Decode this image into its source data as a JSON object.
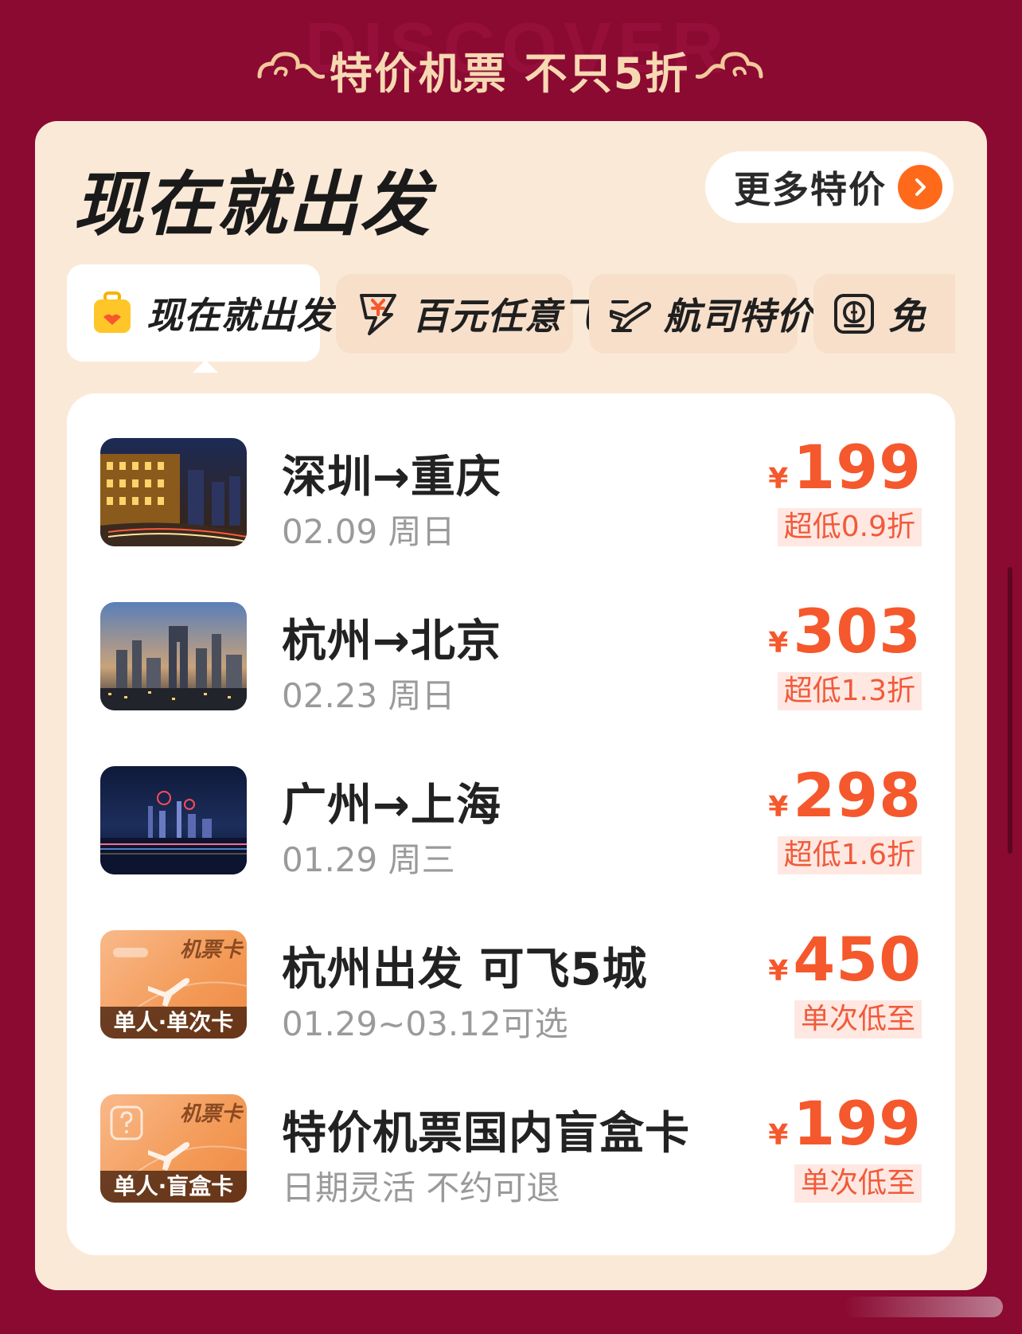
{
  "banner": {
    "ghost_text": "DISCOVER",
    "title": "特价机票 不只5折"
  },
  "card": {
    "title": "现在就出发",
    "more_label": "更多特价"
  },
  "tabs": [
    {
      "label": "现在就出发",
      "icon": "suitcase-icon",
      "active": true
    },
    {
      "label": "百元任意飞",
      "icon": "yen-lightning-icon",
      "active": false
    },
    {
      "label": "航司特价",
      "icon": "airplane-ticket-icon",
      "active": false
    },
    {
      "label": "免",
      "icon": "passport-icon",
      "active": false
    }
  ],
  "deals": [
    {
      "title": "深圳→重庆",
      "subtitle": "02.09 周日",
      "currency": "¥",
      "price": "199",
      "badge": "超低0.9折",
      "thumb": "chongqing-night-photo"
    },
    {
      "title": "杭州→北京",
      "subtitle": "02.23 周日",
      "currency": "¥",
      "price": "303",
      "badge": "超低1.3折",
      "thumb": "beijing-skyline-photo"
    },
    {
      "title": "广州→上海",
      "subtitle": "01.29 周三",
      "currency": "¥",
      "price": "298",
      "badge": "超低1.6折",
      "thumb": "shanghai-bund-photo"
    },
    {
      "title": "杭州出发 可飞5城",
      "subtitle": "01.29~03.12可选",
      "currency": "¥",
      "price": "450",
      "badge": "单次低至",
      "thumb_tag": "机票卡",
      "thumb_label": "单人·单次卡"
    },
    {
      "title": "特价机票国内盲盒卡",
      "subtitle": "日期灵活 不约可退",
      "currency": "¥",
      "price": "199",
      "badge": "单次低至",
      "thumb_tag": "机票卡",
      "thumb_label": "单人·盲盒卡"
    }
  ],
  "colors": {
    "background": "#8a0a32",
    "card": "#fbe9d8",
    "accent": "#f5582c",
    "more_arrow": "#ff6a1a"
  }
}
